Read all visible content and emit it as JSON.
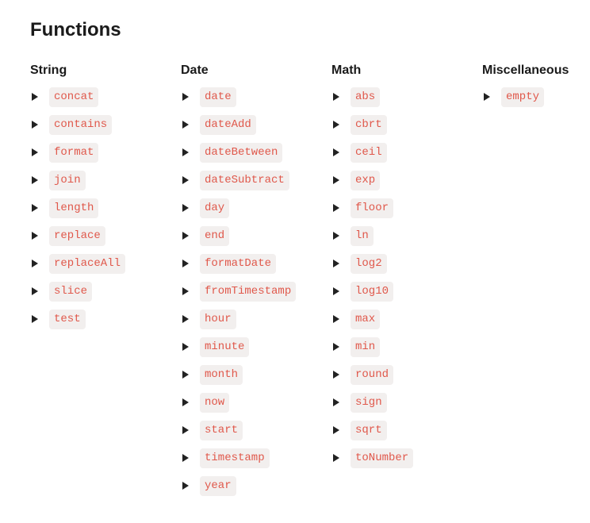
{
  "title": "Functions",
  "columns": [
    {
      "heading": "String",
      "items": [
        "concat",
        "contains",
        "format",
        "join",
        "length",
        "replace",
        "replaceAll",
        "slice",
        "test"
      ]
    },
    {
      "heading": "Date",
      "items": [
        "date",
        "dateAdd",
        "dateBetween",
        "dateSubtract",
        "day",
        "end",
        "formatDate",
        "fromTimestamp",
        "hour",
        "minute",
        "month",
        "now",
        "start",
        "timestamp",
        "year"
      ]
    },
    {
      "heading": "Math",
      "items": [
        "abs",
        "cbrt",
        "ceil",
        "exp",
        "floor",
        "ln",
        "log2",
        "log10",
        "max",
        "min",
        "round",
        "sign",
        "sqrt",
        "toNumber"
      ]
    },
    {
      "heading": "Miscellaneous",
      "items": [
        "empty"
      ]
    }
  ]
}
